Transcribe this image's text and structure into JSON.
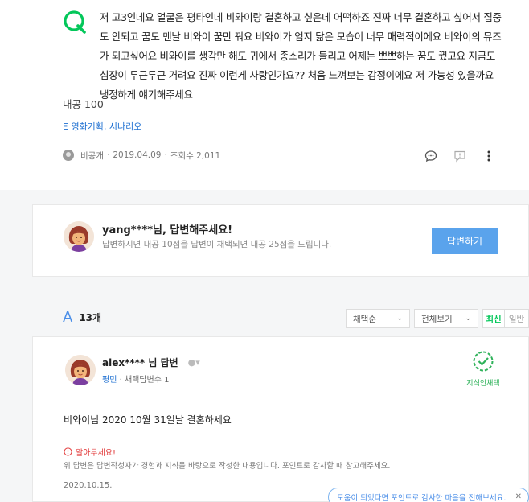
{
  "question": {
    "body": "저 고3인데요 얼굴은 평타인데 비와이랑 결혼하고 싶은데 어떡하죠 진짜 너무 결혼하고 싶어서 집중도 안되고 꿈도 맨날 비와이 꿈만 꿔요 비와이가 엄지 닮은 모습이 너무 매력적이에요 비와이의 뮤즈가 되고싶어요 비와이를 생각만 해도 귀에서 종소리가 들리고 어제는 뽀뽀하는 꿈도 꿨고요 지금도 심장이 두근두근 거려요 진짜 이런게 사랑인가요?? 처음 느껴보는 감정이에요 저 가능성 있을까요 냉정하게 얘기해주세요",
    "bounty": "내공 100",
    "category": "Ξ 영화기획, 시나리오",
    "author": "비공개",
    "date": "2019.04.09",
    "views": "조회수 2,011"
  },
  "prompt": {
    "title": "yang****님, 답변해주세요!",
    "desc": "답변하시면 내공 10점을 답변이 채택되면 내공 25점을 드립니다.",
    "button": "답변하기"
  },
  "answers_header": {
    "mark": "A",
    "count": "13개",
    "filter_select": "채택순",
    "filter_view": "전체보기",
    "sort_latest": "최신",
    "sort_general": "일반"
  },
  "answer": {
    "name": "alex**** 님 답변",
    "grade": "평민",
    "stats": "채택답변수 1",
    "chosen_label": "지식인채택",
    "text": "비와이님 2020 10월 31일날 결혼하세요",
    "notice_title": "알아두세요!",
    "notice_body": "위 답변은 답변작성자가 경험과 지식을 바탕으로 작성한 내용입니다. 포인트로 감사할 때 참고해주세요.",
    "date": "2020.10.15."
  },
  "toast": {
    "text": "도움이 되었다면 포인트로 감사한 마음을 전해보세요.",
    "close": "✕"
  },
  "colors": {
    "green": "#03c75a",
    "blue": "#4a8ee8",
    "button": "#5aa3ec"
  }
}
